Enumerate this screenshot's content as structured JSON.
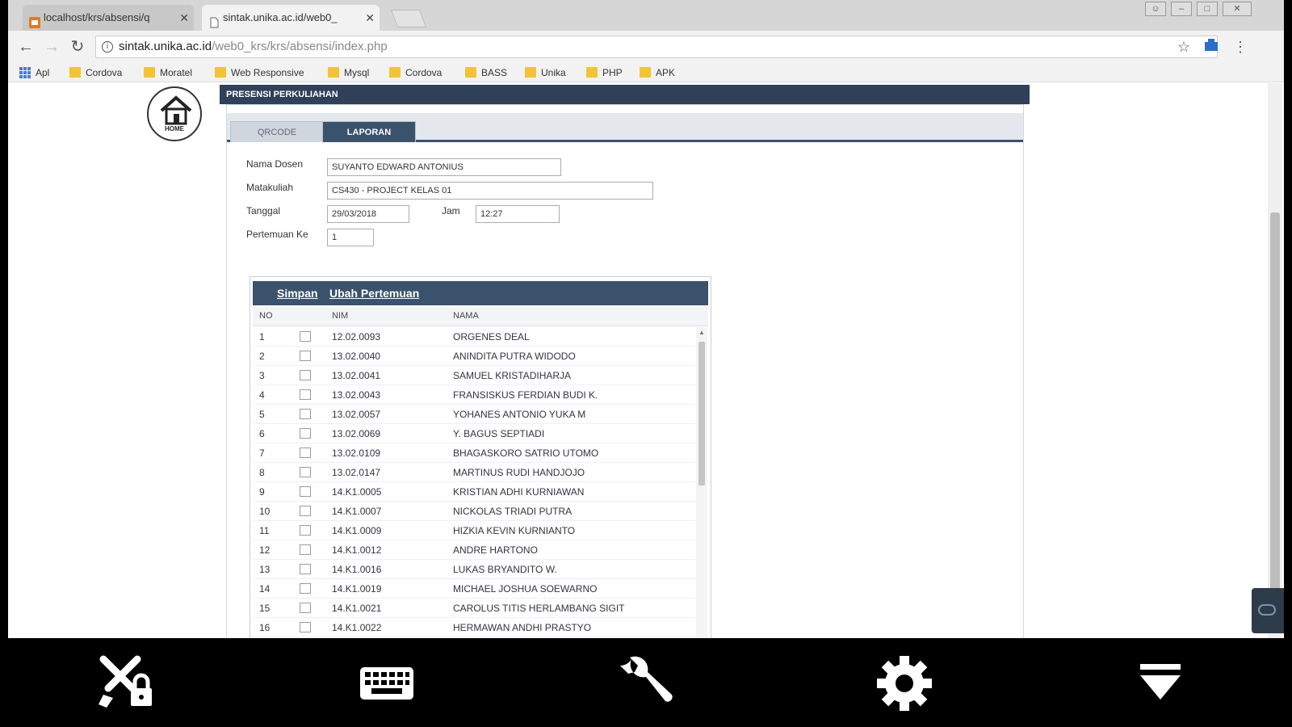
{
  "browser": {
    "tabs": [
      {
        "title": "localhost/krs/absensi/q",
        "active": false
      },
      {
        "title": "sintak.unika.ac.id/web0_",
        "active": true
      }
    ],
    "url_host": "sintak.unika.ac.id",
    "url_path": "/web0_krs/krs/absensi/index.php",
    "bookmarks": [
      "Apl",
      "Cordova",
      "Moratel",
      "Web Responsive",
      "Mysql",
      "Cordova",
      "BASS",
      "Unika",
      "PHP",
      "APK"
    ]
  },
  "page": {
    "home_logo_text": "HOME",
    "panel_title": "PRESENSI PERKULIAHAN",
    "tabs": [
      "QRCODE",
      "LAPORAN"
    ],
    "form": {
      "dosen_label": "Nama Dosen",
      "dosen_value": "SUYANTO EDWARD ANTONIUS",
      "matakuliah_label": "Matakuliah",
      "matakuliah_value": "CS430 - PROJECT   KELAS 01",
      "tanggal_label": "Tanggal",
      "tanggal_value": "29/03/2018",
      "jam_label": "Jam",
      "jam_value": "12:27",
      "pertemuan_label": "Pertemuan Ke",
      "pertemuan_value": "1"
    },
    "grid": {
      "simpan_label": "Simpan",
      "ubah_label": "Ubah Pertemuan",
      "columns": [
        "NO",
        "",
        "NIM",
        "NAMA"
      ],
      "rows": [
        {
          "no": "1",
          "nim": "12.02.0093",
          "nama": "ORGENES DEAL"
        },
        {
          "no": "2",
          "nim": "13.02.0040",
          "nama": "ANINDITA PUTRA WIDODO"
        },
        {
          "no": "3",
          "nim": "13.02.0041",
          "nama": "SAMUEL KRISTADIHARJA"
        },
        {
          "no": "4",
          "nim": "13.02.0043",
          "nama": "FRANSISKUS FERDIAN BUDI K."
        },
        {
          "no": "5",
          "nim": "13.02.0057",
          "nama": "YOHANES ANTONIO YUKA M"
        },
        {
          "no": "6",
          "nim": "13.02.0069",
          "nama": "Y. BAGUS SEPTIADI"
        },
        {
          "no": "7",
          "nim": "13.02.0109",
          "nama": "BHAGASKORO SATRIO UTOMO"
        },
        {
          "no": "8",
          "nim": "13.02.0147",
          "nama": "MARTINUS RUDI HANDJOJO"
        },
        {
          "no": "9",
          "nim": "14.K1.0005",
          "nama": "KRISTIAN ADHI KURNIAWAN"
        },
        {
          "no": "10",
          "nim": "14.K1.0007",
          "nama": "NICKOLAS TRIADI PUTRA"
        },
        {
          "no": "11",
          "nim": "14.K1.0009",
          "nama": "HIZKIA KEVIN KURNIANTO"
        },
        {
          "no": "12",
          "nim": "14.K1.0012",
          "nama": "ANDRE HARTONO"
        },
        {
          "no": "13",
          "nim": "14.K1.0016",
          "nama": "LUKAS BRYANDITO W."
        },
        {
          "no": "14",
          "nim": "14.K1.0019",
          "nama": "MICHAEL JOSHUA SOEWARNO"
        },
        {
          "no": "15",
          "nim": "14.K1.0021",
          "nama": "CAROLUS TITIS HERLAMBANG SIGIT"
        },
        {
          "no": "16",
          "nim": "14.K1.0022",
          "nama": "HERMAWAN ANDHI PRASTYO"
        }
      ]
    }
  },
  "bottom_bar": {
    "icons": [
      "tools-lock-icon",
      "keyboard-icon",
      "wrench-icon",
      "gear-icon",
      "collapse-down-icon"
    ]
  }
}
